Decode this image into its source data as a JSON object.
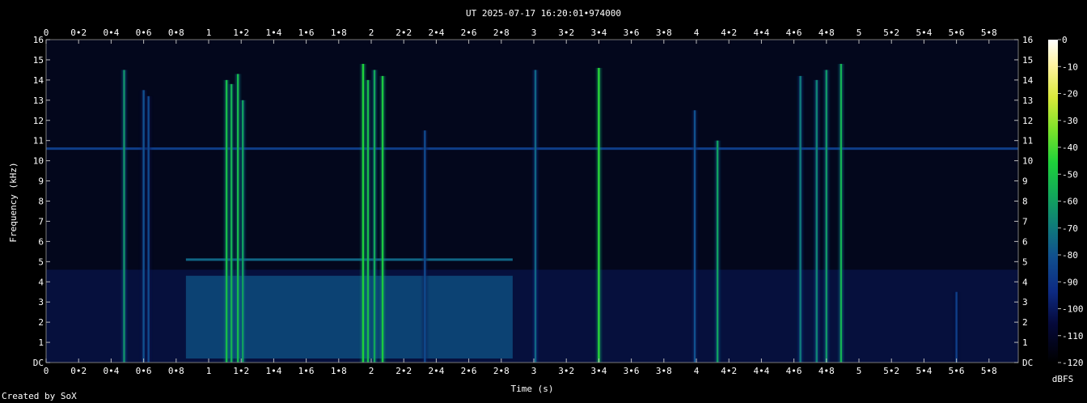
{
  "title": "UT 2025-07-17 16:20:01•974000",
  "credit": "Created by SoX",
  "colorbar": {
    "unit": "dBFS",
    "ticks": [
      "0",
      "-10",
      "-20",
      "-30",
      "-40",
      "-50",
      "-60",
      "-70",
      "-80",
      "-90",
      "-100",
      "-110",
      "-120"
    ]
  },
  "chart_data": {
    "type": "heatmap",
    "title": "UT 2025-07-17 16:20:01•974000",
    "xlabel": "Time (s)",
    "ylabel": "Frequency (kHz)",
    "xlim": [
      0,
      5.98
    ],
    "ylim": [
      0,
      16
    ],
    "zlim": [
      -120,
      0
    ],
    "zunit": "dBFS",
    "x_ticks": [
      "0",
      "0•2",
      "0•4",
      "0•6",
      "0•8",
      "1",
      "1•2",
      "1•4",
      "1•6",
      "1•8",
      "2",
      "2•2",
      "2•4",
      "2•6",
      "2•8",
      "3",
      "3•2",
      "3•4",
      "3•6",
      "3•8",
      "4",
      "4•2",
      "4•4",
      "4•6",
      "4•8",
      "5",
      "5•2",
      "5•4",
      "5•6",
      "5•8"
    ],
    "y_ticks": [
      "DC",
      "1",
      "2",
      "3",
      "4",
      "5",
      "6",
      "7",
      "8",
      "9",
      "10",
      "11",
      "12",
      "13",
      "14",
      "15",
      "16"
    ],
    "background_level_db": -110,
    "tones": [
      {
        "freq_khz": 10.6,
        "t_start": 0,
        "t_end": 5.98,
        "level_db": -95
      },
      {
        "freq_khz": 5.1,
        "t_start": 0.86,
        "t_end": 2.87,
        "level_db": -85
      }
    ],
    "low_band": {
      "t_start": 0.86,
      "t_end": 2.87,
      "f_low_khz": 0.2,
      "f_high_khz": 4.3,
      "level_db": -88
    },
    "transients": [
      {
        "t": 0.48,
        "f_top_khz": 14.5,
        "level_db": -75
      },
      {
        "t": 0.6,
        "f_top_khz": 13.5,
        "level_db": -90
      },
      {
        "t": 0.63,
        "f_top_khz": 13.2,
        "level_db": -92
      },
      {
        "t": 1.11,
        "f_top_khz": 14.0,
        "level_db": -65
      },
      {
        "t": 1.14,
        "f_top_khz": 13.8,
        "level_db": -68
      },
      {
        "t": 1.18,
        "f_top_khz": 14.3,
        "level_db": -66
      },
      {
        "t": 1.21,
        "f_top_khz": 13.0,
        "level_db": -72
      },
      {
        "t": 1.95,
        "f_top_khz": 14.8,
        "level_db": -60
      },
      {
        "t": 1.98,
        "f_top_khz": 14.0,
        "level_db": -65
      },
      {
        "t": 2.02,
        "f_top_khz": 14.5,
        "level_db": -70
      },
      {
        "t": 2.07,
        "f_top_khz": 14.2,
        "level_db": -62
      },
      {
        "t": 2.33,
        "f_top_khz": 11.5,
        "level_db": -92
      },
      {
        "t": 3.01,
        "f_top_khz": 14.5,
        "level_db": -85
      },
      {
        "t": 3.4,
        "f_top_khz": 14.6,
        "level_db": -58
      },
      {
        "t": 3.99,
        "f_top_khz": 12.5,
        "level_db": -90
      },
      {
        "t": 4.13,
        "f_top_khz": 11.0,
        "level_db": -72
      },
      {
        "t": 4.64,
        "f_top_khz": 14.2,
        "level_db": -80
      },
      {
        "t": 4.74,
        "f_top_khz": 14.0,
        "level_db": -78
      },
      {
        "t": 4.8,
        "f_top_khz": 14.5,
        "level_db": -74
      },
      {
        "t": 4.89,
        "f_top_khz": 14.8,
        "level_db": -68
      },
      {
        "t": 5.6,
        "f_top_khz": 3.5,
        "level_db": -95
      }
    ]
  }
}
